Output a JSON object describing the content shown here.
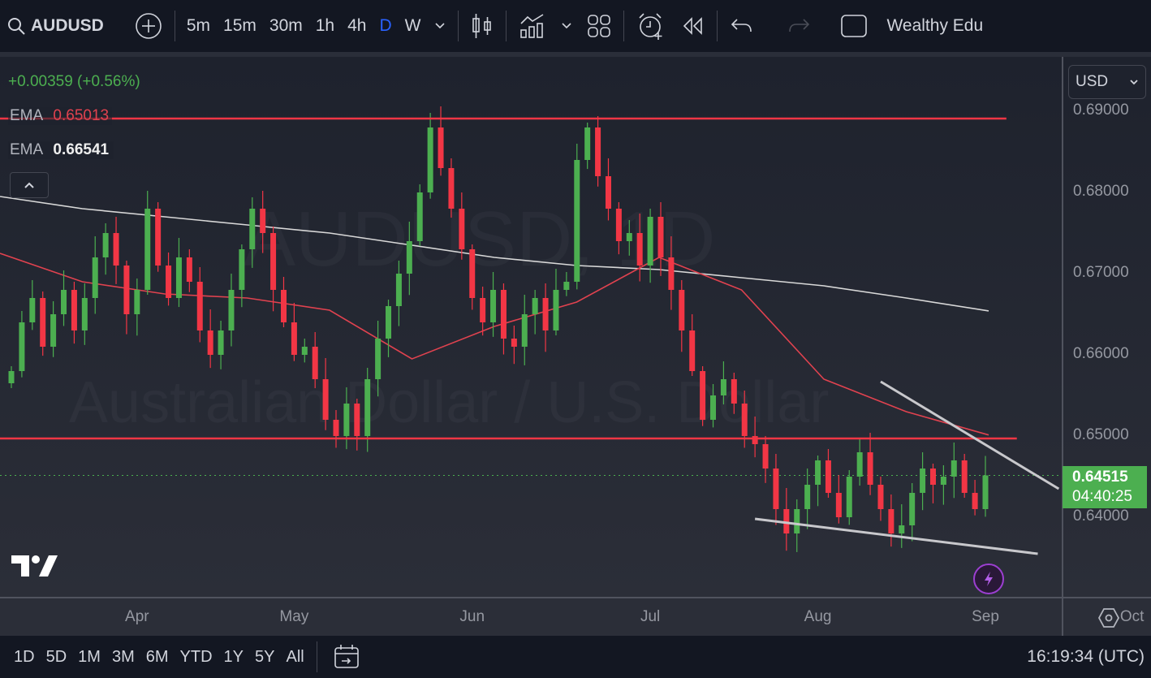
{
  "toolbar": {
    "symbol": "AUDUSD",
    "intervals": [
      "5m",
      "15m",
      "30m",
      "1h",
      "4h",
      "D",
      "W"
    ],
    "active_interval": "D",
    "account_label": "Wealthy Edu"
  },
  "legend": {
    "change": "+0.00359 (+0.56%)",
    "ema1_label": "EMA",
    "ema1_value": "0.65013",
    "ema2_label": "EMA",
    "ema2_value": "0.66541"
  },
  "watermark": {
    "line1": "AUDUSD, 1D",
    "line2": "Australian Dollar / U.S. Dollar"
  },
  "price_axis": {
    "currency": "USD",
    "ticks": [
      "0.69000",
      "0.68000",
      "0.67000",
      "0.66000",
      "0.65000",
      "0.64000"
    ],
    "current_price": "0.64515",
    "countdown": "04:40:25"
  },
  "time_axis": {
    "ticks": [
      "Apr",
      "May",
      "Jun",
      "Jul",
      "Aug",
      "Sep",
      "Oct"
    ]
  },
  "bottom": {
    "ranges": [
      "1D",
      "5D",
      "1M",
      "3M",
      "6M",
      "YTD",
      "1Y",
      "5Y",
      "All"
    ],
    "clock": "16:19:34 (UTC)"
  },
  "colors": {
    "up": "#4caf50",
    "down": "#f23645",
    "ema_fast": "#e0424f",
    "ema_slow": "#d8d8d8",
    "accent": "#2962ff"
  },
  "chart_data": {
    "type": "candlestick",
    "symbol": "AUDUSD",
    "timeframe": "1D",
    "ylim": [
      0.6335,
      0.6955
    ],
    "first_open": 0.6565,
    "closes": [
      0.658,
      0.664,
      0.667,
      0.661,
      0.665,
      0.668,
      0.663,
      0.667,
      0.672,
      0.675,
      0.671,
      0.665,
      0.668,
      0.678,
      0.671,
      0.667,
      0.672,
      0.669,
      0.663,
      0.66,
      0.663,
      0.668,
      0.673,
      0.678,
      0.675,
      0.668,
      0.664,
      0.66,
      0.661,
      0.657,
      0.652,
      0.65,
      0.654,
      0.65,
      0.657,
      0.662,
      0.666,
      0.67,
      0.674,
      0.68,
      0.688,
      0.683,
      0.678,
      0.673,
      0.667,
      0.664,
      0.668,
      0.662,
      0.661,
      0.665,
      0.667,
      0.663,
      0.668,
      0.669,
      0.684,
      0.688,
      0.682,
      0.678,
      0.674,
      0.675,
      0.671,
      0.677,
      0.672,
      0.668,
      0.663,
      0.658,
      0.652,
      0.655,
      0.657,
      0.654,
      0.65,
      0.649,
      0.646,
      0.641,
      0.638,
      0.641,
      0.644,
      0.647,
      0.643,
      0.64,
      0.645,
      0.648,
      0.644,
      0.641,
      0.638,
      0.639,
      0.643,
      0.646,
      0.644,
      0.645,
      0.647,
      0.643,
      0.641,
      0.64515
    ],
    "ema_fast": [
      0.6725,
      0.669,
      0.6675,
      0.667,
      0.6655,
      0.6595,
      0.6635,
      0.6665,
      0.672,
      0.668,
      0.657,
      0.653,
      0.65013
    ],
    "ema_slow": [
      0.6795,
      0.678,
      0.677,
      0.676,
      0.675,
      0.6735,
      0.672,
      0.671,
      0.6705,
      0.6695,
      0.6685,
      0.667,
      0.66541
    ],
    "horizontal_levels": [
      {
        "price": 0.6891,
        "from_index": 0,
        "to_index": 95
      },
      {
        "price": 0.6497,
        "from_index": 0,
        "to_index": 96
      }
    ],
    "trendlines": [
      {
        "from": [
          83,
          0.6567
        ],
        "to": [
          100,
          0.6435
        ]
      },
      {
        "from": [
          71,
          0.6398
        ],
        "to": [
          98,
          0.6355
        ]
      }
    ],
    "xtick_indices": [
      12,
      27,
      44,
      61,
      77,
      93,
      107
    ]
  }
}
